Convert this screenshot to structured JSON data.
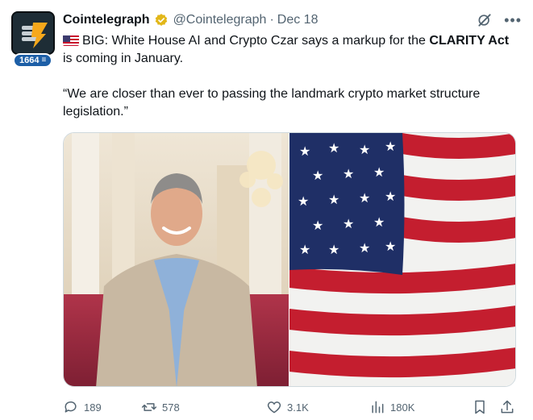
{
  "author": {
    "name": "Cointelegraph",
    "handle": "@Cointelegraph",
    "separator": "·",
    "date": "Dec 18",
    "badge_count": "1664"
  },
  "tweet": {
    "line1_prefix": "BIG: White House AI and Crypto Czar says a markup for the ",
    "line1_bold": "CLARITY Act",
    "line1_suffix": " is coming in January.",
    "quote": "“We are closer than ever to passing the landmark crypto market structure legislation.”"
  },
  "actions": {
    "replies": "189",
    "reposts": "578",
    "likes": "3.1K",
    "views": "180K"
  },
  "icons": {
    "verified": "verified-gold-badge-icon",
    "grok": "grok-icon",
    "more": "more-icon",
    "reply": "reply-icon",
    "repost": "repost-icon",
    "like": "heart-icon",
    "views": "views-icon",
    "bookmark": "bookmark-icon",
    "share": "share-icon"
  },
  "colors": {
    "text": "#0f1419",
    "secondary": "#536471",
    "verified_gold": "#e2b719",
    "badge_blue": "#1d5fa7"
  }
}
